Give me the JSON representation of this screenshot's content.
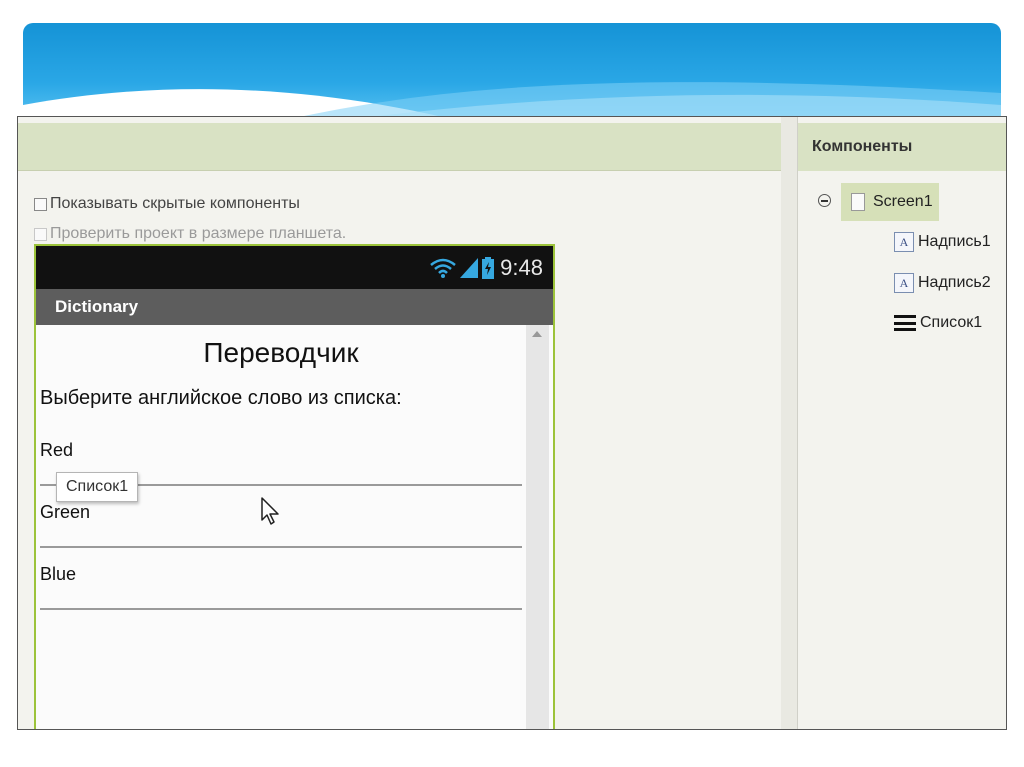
{
  "viewer": {
    "options": {
      "show_hidden": "Показывать скрытые компоненты",
      "tablet_size": "Проверить проект в размере планшета."
    },
    "phone": {
      "status_time": "9:48",
      "app_title": "Dictionary",
      "label1": "Переводчик",
      "label2": "Выберите английское слово из списка:",
      "list_items": [
        "Red",
        "Green",
        "Blue"
      ],
      "tooltip": "Список1"
    }
  },
  "components": {
    "header": "Компоненты",
    "tree": {
      "screen": "Screen1",
      "children": [
        "Надпись1",
        "Надпись2",
        "Список1"
      ],
      "label_icon_glyph": "A"
    }
  },
  "colors": {
    "panel_header": "#d9e2c4",
    "phone_border": "#9cc33a",
    "selected_row": "#d6e0b8",
    "banner": "#1593d6"
  }
}
